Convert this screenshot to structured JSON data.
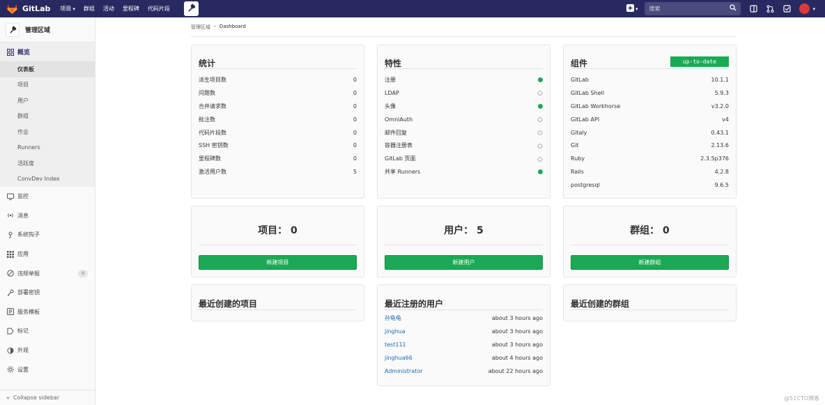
{
  "topbar": {
    "brand": "GitLab",
    "nav": [
      {
        "label": "项目",
        "dropdown": true
      },
      {
        "label": "群组"
      },
      {
        "label": "活动"
      },
      {
        "label": "里程碑"
      },
      {
        "label": "代码片段"
      }
    ],
    "search_placeholder": "搜索"
  },
  "sidebar": {
    "title": "管理区域",
    "overview_label": "概览",
    "sub_items": [
      "仪表板",
      "项目",
      "用户",
      "群组",
      "作业",
      "Runners",
      "活跃度",
      "ConvDev Index"
    ],
    "items": [
      {
        "label": "监控",
        "icon": "monitor-icon"
      },
      {
        "label": "消息",
        "icon": "broadcast-icon"
      },
      {
        "label": "系统钩子",
        "icon": "hook-icon"
      },
      {
        "label": "应用",
        "icon": "apps-icon"
      },
      {
        "label": "违规举报",
        "icon": "flag-icon",
        "badge": "0"
      },
      {
        "label": "部署密钥",
        "icon": "key-icon"
      },
      {
        "label": "服务模板",
        "icon": "template-icon"
      },
      {
        "label": "标记",
        "icon": "label-icon"
      },
      {
        "label": "外观",
        "icon": "appearance-icon"
      },
      {
        "label": "设置",
        "icon": "settings-icon"
      }
    ],
    "collapse_label": "Collapse sidebar"
  },
  "breadcrumb": {
    "parent": "管理区域",
    "current": "Dashboard"
  },
  "stats": {
    "title": "统计",
    "rows": [
      {
        "label": "派生项目数",
        "value": "0"
      },
      {
        "label": "问题数",
        "value": "0"
      },
      {
        "label": "合并请求数",
        "value": "0"
      },
      {
        "label": "批注数",
        "value": "0"
      },
      {
        "label": "代码片段数",
        "value": "0"
      },
      {
        "label": "SSH 密钥数",
        "value": "0"
      },
      {
        "label": "里程碑数",
        "value": "0"
      },
      {
        "label": "激活用户数",
        "value": "5"
      }
    ]
  },
  "features": {
    "title": "特性",
    "rows": [
      {
        "label": "注册",
        "enabled": true
      },
      {
        "label": "LDAP",
        "enabled": false
      },
      {
        "label": "头像",
        "enabled": true
      },
      {
        "label": "OmniAuth",
        "enabled": false
      },
      {
        "label": "邮件回复",
        "enabled": false
      },
      {
        "label": "容器注册表",
        "enabled": false
      },
      {
        "label": "GitLab 页面",
        "enabled": false
      },
      {
        "label": "共享 Runners",
        "enabled": true
      }
    ]
  },
  "components": {
    "title": "组件",
    "status": "up-to-date",
    "rows": [
      {
        "label": "GitLab",
        "value": "10.1.1"
      },
      {
        "label": "GitLab Shell",
        "value": "5.9.3"
      },
      {
        "label": "GitLab Workhorse",
        "value": "v3.2.0"
      },
      {
        "label": "GitLab API",
        "value": "v4"
      },
      {
        "label": "Gitaly",
        "value": "0.43.1"
      },
      {
        "label": "Git",
        "value": "2.13.6"
      },
      {
        "label": "Ruby",
        "value": "2.3.5p376"
      },
      {
        "label": "Rails",
        "value": "4.2.8"
      },
      {
        "label": "postgresql",
        "value": "9.6.5"
      }
    ]
  },
  "counts": [
    {
      "label": "项目： 0",
      "button": "新建项目"
    },
    {
      "label": "用户： 5",
      "button": "新建用户"
    },
    {
      "label": "群组： 0",
      "button": "新建群组"
    }
  ],
  "recent": {
    "projects_title": "最近创建的项目",
    "users_title": "最近注册的用户",
    "groups_title": "最近创建的群组",
    "users": [
      {
        "name": "孙龟龟",
        "time": "about 3 hours ago"
      },
      {
        "name": "jinghua",
        "time": "about 3 hours ago"
      },
      {
        "name": "test111",
        "time": "about 3 hours ago"
      },
      {
        "name": "jinghua66",
        "time": "about 4 hours ago"
      },
      {
        "name": "Administrator",
        "time": "about 22 hours ago"
      }
    ]
  },
  "watermark": "@51CTO博客",
  "colors": {
    "nav": "#292961",
    "success": "#1aaa55",
    "link": "#1b69b6"
  }
}
